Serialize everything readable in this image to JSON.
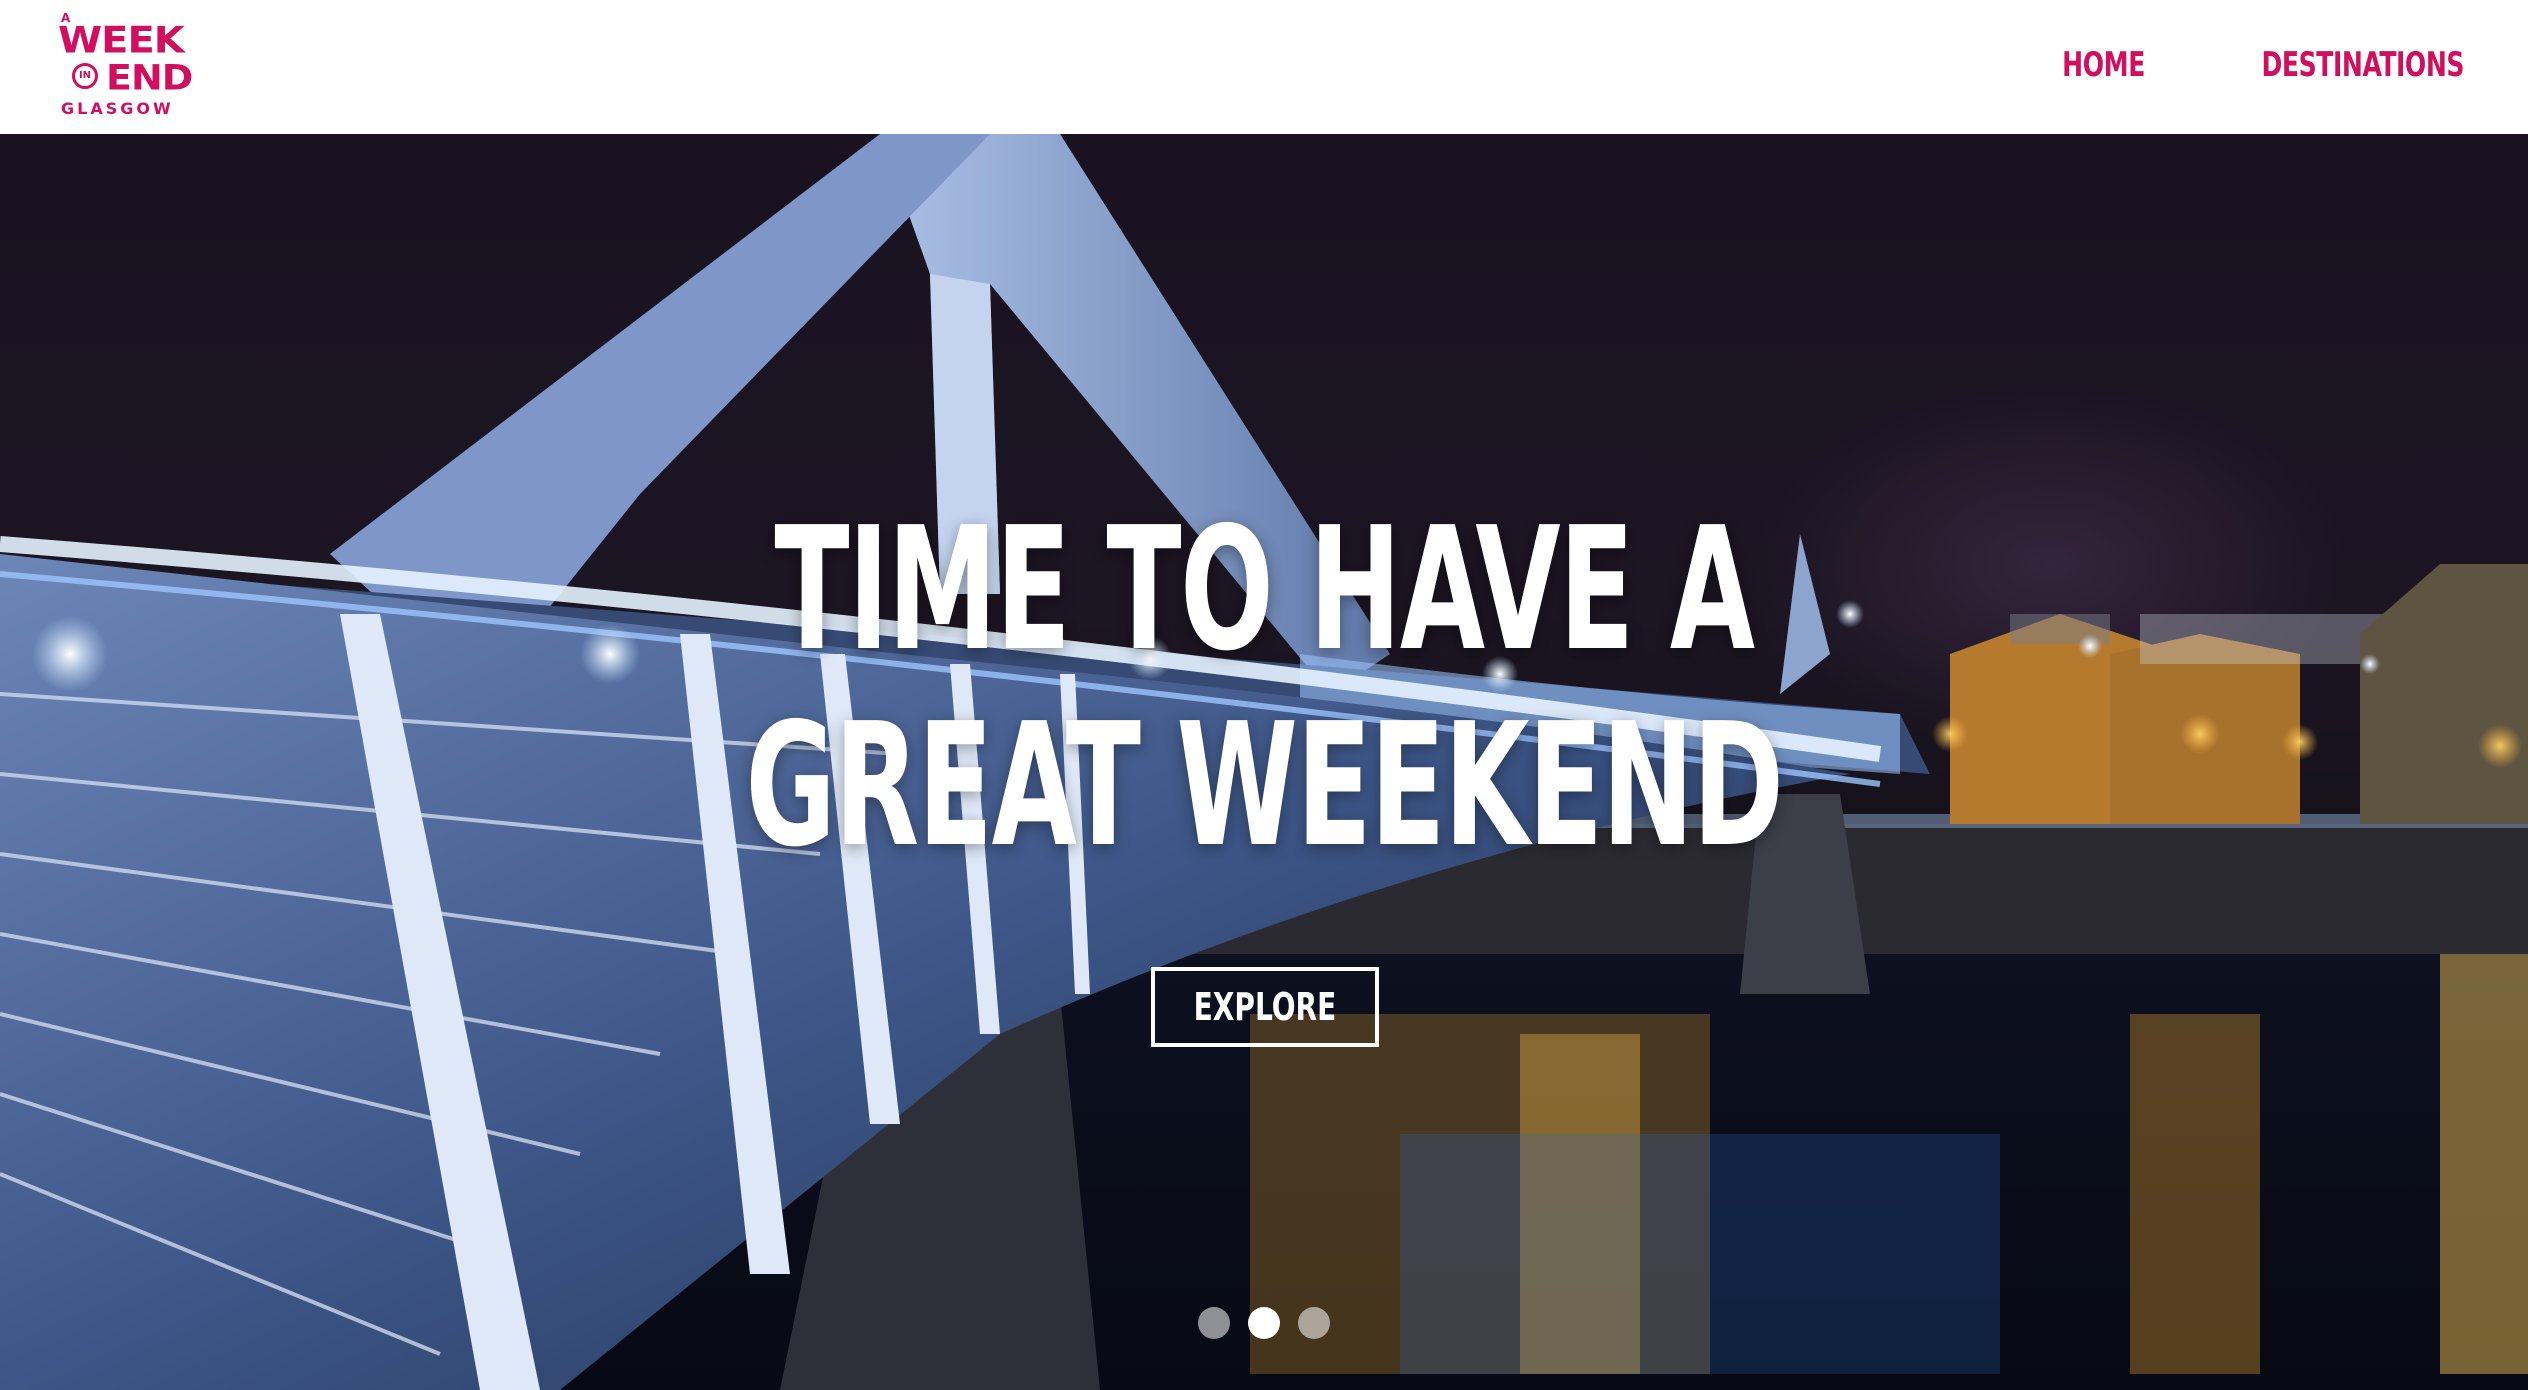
{
  "logo": {
    "a": "A",
    "week": "WEEK",
    "in": "IN",
    "end": "END",
    "city": "GLASGOW"
  },
  "nav": {
    "items": [
      {
        "label": "HOME"
      },
      {
        "label": "DESTINATIONS"
      }
    ]
  },
  "hero": {
    "headline_line1": "TIME TO HAVE A",
    "headline_line2": "GREAT WEEKEND",
    "cta_label": "EXPLORE",
    "slides": 3,
    "active_slide": 2
  },
  "colors": {
    "brand": "#d10f5e",
    "header_bg": "#ffffff",
    "text_on_hero": "#ffffff"
  }
}
